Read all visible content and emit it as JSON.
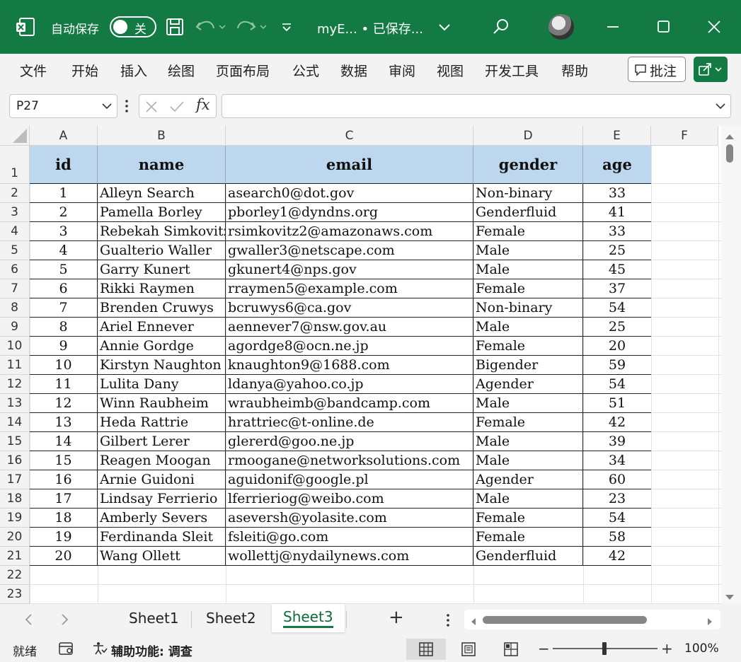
{
  "titlebar": {
    "autosave_label": "自动保存",
    "autosave_state": "关",
    "doc_title": "myE...  •  已保存...",
    "accent": "#127a42"
  },
  "menu": {
    "items": [
      "文件",
      "开始",
      "插入",
      "绘图",
      "页面布局",
      "公式",
      "数据",
      "审阅",
      "视图",
      "开发工具",
      "帮助"
    ],
    "comment_label": "批注"
  },
  "formula_bar": {
    "name_box": "P27",
    "formula": ""
  },
  "grid": {
    "columns": [
      "A",
      "B",
      "C",
      "D",
      "E",
      "F"
    ],
    "row_numbers": [
      "1",
      "2",
      "3",
      "4",
      "5",
      "6",
      "7",
      "8",
      "9",
      "10",
      "11",
      "12",
      "13",
      "14",
      "15",
      "16",
      "17",
      "18",
      "19",
      "20",
      "21",
      "22",
      "23"
    ],
    "headers": [
      "id",
      "name",
      "email",
      "gender",
      "age"
    ],
    "header_fill": "#bdd7ee",
    "rows": [
      [
        "1",
        "Alleyn Search",
        "asearch0@dot.gov",
        "Non-binary",
        "33"
      ],
      [
        "2",
        "Pamella Borley",
        "pborley1@dyndns.org",
        "Genderfluid",
        "41"
      ],
      [
        "3",
        "Rebekah Simkovitz",
        "rsimkovitz2@amazonaws.com",
        "Female",
        "33"
      ],
      [
        "4",
        "Gualterio Waller",
        "gwaller3@netscape.com",
        "Male",
        "25"
      ],
      [
        "5",
        "Garry Kunert",
        "gkunert4@nps.gov",
        "Male",
        "45"
      ],
      [
        "6",
        "Rikki Raymen",
        "rraymen5@example.com",
        "Female",
        "37"
      ],
      [
        "7",
        "Brenden Cruwys",
        "bcruwys6@ca.gov",
        "Non-binary",
        "54"
      ],
      [
        "8",
        "Ariel Ennever",
        "aennever7@nsw.gov.au",
        "Male",
        "25"
      ],
      [
        "9",
        "Annie Gordge",
        "agordge8@ocn.ne.jp",
        "Female",
        "20"
      ],
      [
        "10",
        "Kirstyn Naughton",
        "knaughton9@1688.com",
        "Bigender",
        "59"
      ],
      [
        "11",
        "Lulita Dany",
        "ldanya@yahoo.co.jp",
        "Agender",
        "54"
      ],
      [
        "12",
        "Winn Raubheim",
        "wraubheimb@bandcamp.com",
        "Male",
        "51"
      ],
      [
        "13",
        "Heda Rattrie",
        "hrattriec@t-online.de",
        "Female",
        "42"
      ],
      [
        "14",
        "Gilbert Lerer",
        "glererd@goo.ne.jp",
        "Male",
        "39"
      ],
      [
        "15",
        "Reagen Moogan",
        "rmoogane@networksolutions.com",
        "Male",
        "34"
      ],
      [
        "16",
        "Arnie Guidoni",
        "aguidonif@google.pl",
        "Agender",
        "60"
      ],
      [
        "17",
        "Lindsay Ferrierio",
        "lferrieriog@weibo.com",
        "Male",
        "23"
      ],
      [
        "18",
        "Amberly Severs",
        "aseversh@yolasite.com",
        "Female",
        "54"
      ],
      [
        "19",
        "Ferdinanda Sleit",
        "fsleiti@go.com",
        "Female",
        "58"
      ],
      [
        "20",
        "Wang Ollett",
        "wollettj@nydailynews.com",
        "Genderfluid",
        "42"
      ]
    ]
  },
  "sheets": {
    "tabs": [
      "Sheet1",
      "Sheet2",
      "Sheet3"
    ],
    "active": "Sheet3",
    "add_label": "+"
  },
  "status": {
    "ready": "就绪",
    "accessibility": "辅助功能: 调查",
    "zoom": "100%"
  }
}
